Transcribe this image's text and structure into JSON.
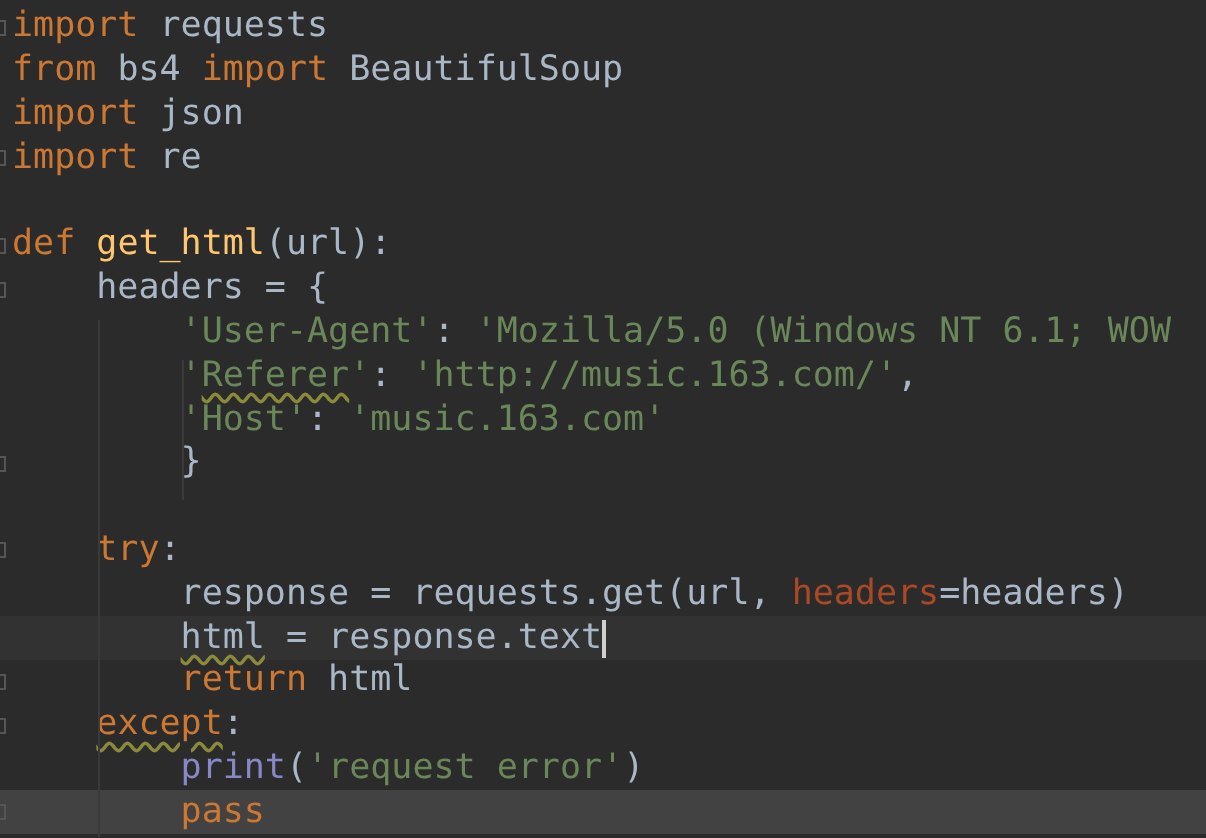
{
  "editor": {
    "lines": [
      {
        "fold": true,
        "current": false,
        "selected": false,
        "tokens": [
          {
            "kind": "keyword",
            "text": "import",
            "warn": false
          },
          {
            "kind": "plain",
            "text": " requests",
            "warn": false
          }
        ]
      },
      {
        "fold": false,
        "current": false,
        "selected": false,
        "tokens": [
          {
            "kind": "keyword",
            "text": "from",
            "warn": false
          },
          {
            "kind": "plain",
            "text": " bs4 ",
            "warn": false
          },
          {
            "kind": "keyword",
            "text": "import",
            "warn": false
          },
          {
            "kind": "plain",
            "text": " BeautifulSoup",
            "warn": false
          }
        ]
      },
      {
        "fold": false,
        "current": false,
        "selected": false,
        "tokens": [
          {
            "kind": "keyword",
            "text": "import",
            "warn": false
          },
          {
            "kind": "plain",
            "text": " json",
            "warn": false
          }
        ]
      },
      {
        "fold": true,
        "current": false,
        "selected": false,
        "tokens": [
          {
            "kind": "keyword",
            "text": "import",
            "warn": false
          },
          {
            "kind": "plain",
            "text": " re",
            "warn": false
          }
        ]
      },
      {
        "fold": false
      },
      {
        "fold": true,
        "current": false,
        "selected": false,
        "tokens": [
          {
            "kind": "keyword",
            "text": "def ",
            "warn": false
          },
          {
            "kind": "function",
            "text": "get_html",
            "warn": false
          },
          {
            "kind": "plain",
            "text": "(url):",
            "warn": false
          }
        ]
      },
      {
        "fold": true,
        "current": false,
        "selected": false,
        "tokens": [
          {
            "kind": "plain",
            "text": "    headers = {",
            "warn": false
          }
        ]
      },
      {
        "fold": false,
        "current": false,
        "selected": false,
        "tokens": [
          {
            "kind": "string",
            "text": "        'User-Agent'",
            "warn": false
          },
          {
            "kind": "plain",
            "text": ": ",
            "warn": false
          },
          {
            "kind": "string",
            "text": "'Mozilla/5.0 (Windows NT 6.1; WOW",
            "warn": false
          }
        ]
      },
      {
        "fold": false,
        "current": false,
        "selected": false,
        "tokens": [
          {
            "kind": "string",
            "text": "        '",
            "warn": false
          },
          {
            "kind": "string",
            "text": "Referer",
            "warn": true
          },
          {
            "kind": "string",
            "text": "'",
            "warn": false
          },
          {
            "kind": "plain",
            "text": ": ",
            "warn": false
          },
          {
            "kind": "string",
            "text": "'http://music.163.com/'",
            "warn": false
          },
          {
            "kind": "plain",
            "text": ",",
            "warn": false
          }
        ]
      },
      {
        "fold": false,
        "current": false,
        "selected": false,
        "tokens": [
          {
            "kind": "string",
            "text": "        'Host'",
            "warn": false
          },
          {
            "kind": "plain",
            "text": ": ",
            "warn": false
          },
          {
            "kind": "string",
            "text": "'music.163.com'",
            "warn": false
          }
        ]
      },
      {
        "fold": true,
        "current": false,
        "selected": false,
        "tokens": [
          {
            "kind": "plain",
            "text": "        }",
            "warn": false
          }
        ]
      },
      {
        "fold": false
      },
      {
        "fold": true,
        "current": false,
        "selected": false,
        "tokens": [
          {
            "kind": "keyword",
            "text": "    try",
            "warn": false
          },
          {
            "kind": "plain",
            "text": ":",
            "warn": false
          }
        ]
      },
      {
        "fold": false,
        "current": false,
        "selected": false,
        "tokens": [
          {
            "kind": "plain",
            "text": "        response = requests.get(url, ",
            "warn": false
          },
          {
            "kind": "param",
            "text": "headers",
            "warn": false
          },
          {
            "kind": "plain",
            "text": "=headers)",
            "warn": false
          }
        ]
      },
      {
        "fold": false,
        "current": true,
        "selected": false,
        "tokens": [
          {
            "kind": "plain",
            "text": "        html",
            "warn": true
          },
          {
            "kind": "plain",
            "text": " = response.text",
            "warn": false
          }
        ]
      },
      {
        "fold": true,
        "current": false,
        "selected": false,
        "tokens": [
          {
            "kind": "keyword",
            "text": "        return",
            "warn": false
          },
          {
            "kind": "plain",
            "text": " html",
            "warn": false
          }
        ]
      },
      {
        "fold": true,
        "current": false,
        "selected": false,
        "tokens": [
          {
            "kind": "keyword",
            "text": "    except",
            "warn": true
          },
          {
            "kind": "plain",
            "text": ":",
            "warn": false
          }
        ]
      },
      {
        "fold": false,
        "current": false,
        "selected": false,
        "tokens": [
          {
            "kind": "builtin",
            "text": "        print",
            "warn": false
          },
          {
            "kind": "plain",
            "text": "(",
            "warn": false
          },
          {
            "kind": "string",
            "text": "'request error'",
            "warn": false
          },
          {
            "kind": "plain",
            "text": ")",
            "warn": false
          }
        ]
      },
      {
        "fold": true,
        "current": false,
        "selected": true,
        "tokens": [
          {
            "kind": "keyword",
            "text": "        pass",
            "warn": false
          }
        ]
      }
    ]
  }
}
